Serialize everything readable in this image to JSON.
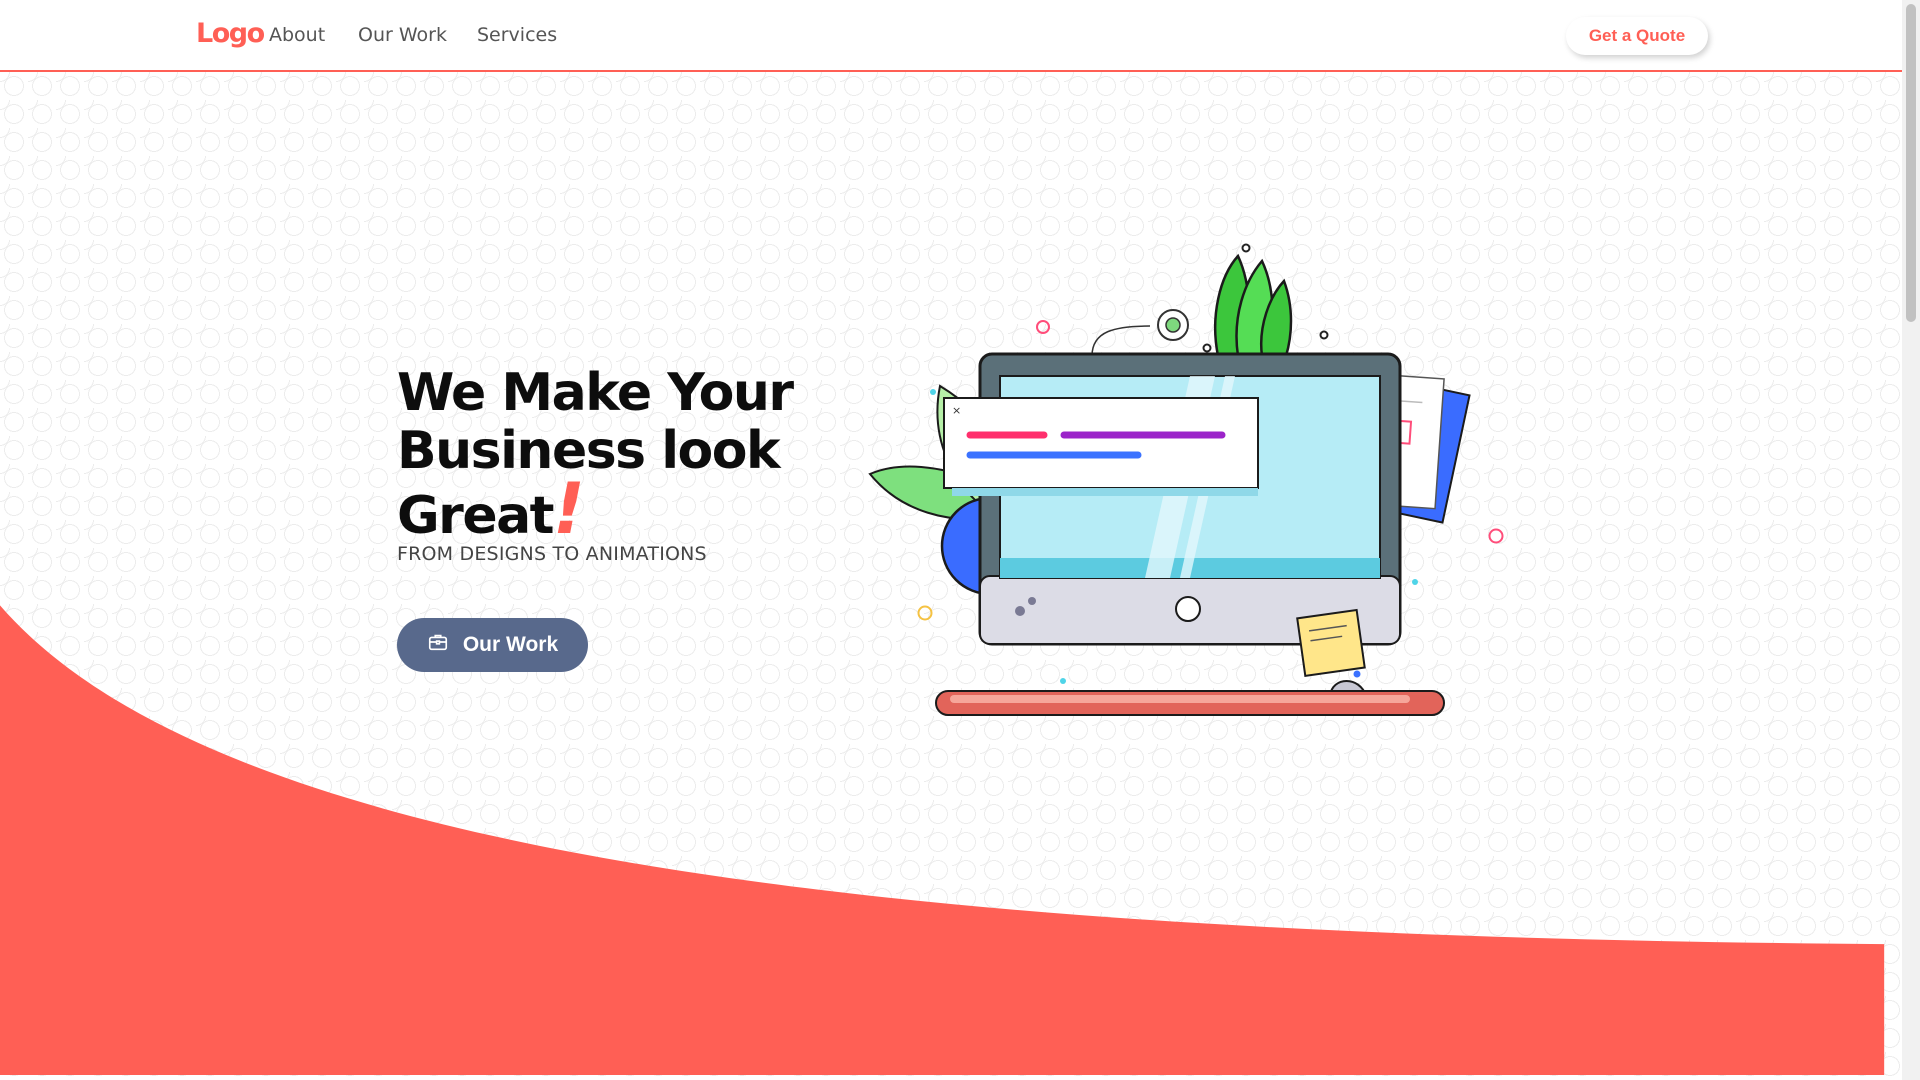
{
  "navbar": {
    "logo": "Logo",
    "links": [
      "About",
      "Our Work",
      "Services"
    ],
    "quote_button": "Get a Quote"
  },
  "hero": {
    "title_line1": "We Make Your",
    "title_line2": "Business look",
    "title_line3": "Great",
    "title_exclaim": "!",
    "subtitle": "FROM DESIGNS TO ANIMATIONS",
    "cta_label": "Our Work",
    "cta_icon": "briefcase-icon"
  },
  "illustration": {
    "name": "monitor-illustration",
    "window_close": "×"
  },
  "colors": {
    "accent": "#ff5f55",
    "button": "#58698c",
    "text": "#0d0d0d"
  }
}
